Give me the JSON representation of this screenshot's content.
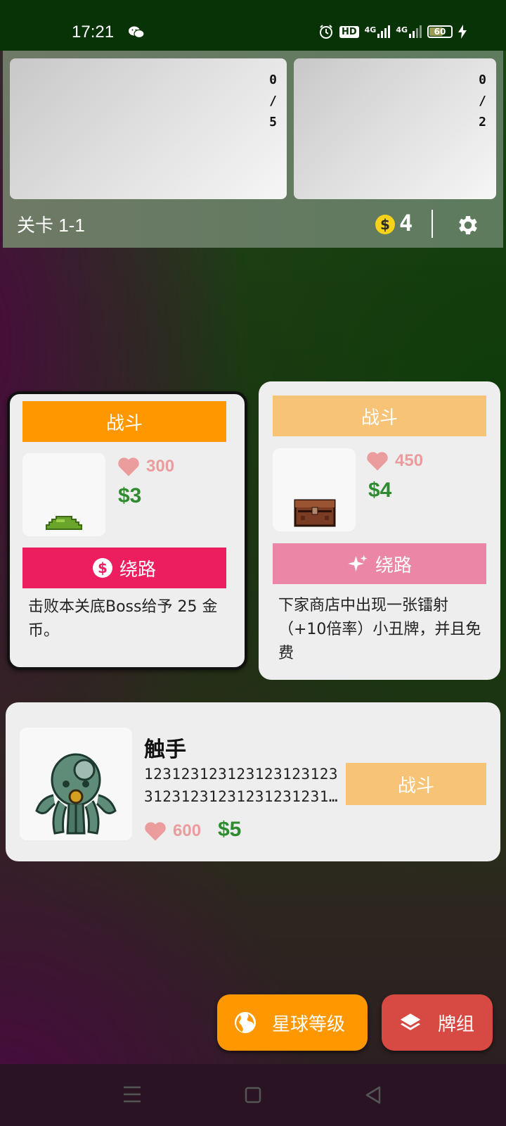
{
  "status_bar": {
    "time": "17:21",
    "icons": [
      "wechat-icon",
      "alarm-icon",
      "hd-icon",
      "signal-4g-icon",
      "signal-4g-icon",
      "battery-icon",
      "charging-icon"
    ],
    "hd_label": "HD",
    "net1": "4G",
    "net2": "4G",
    "battery": "60"
  },
  "header": {
    "slot1": {
      "current": "0",
      "sep": "/",
      "total": "5"
    },
    "slot2": {
      "current": "0",
      "sep": "/",
      "total": "2"
    },
    "level": "关卡 1-1",
    "coin_symbol": "$",
    "coins": "4"
  },
  "cards": [
    {
      "fight_label": "战斗",
      "hp": "300",
      "money": "$3",
      "detour_label": "绕路",
      "description": "击败本关底Boss给予 25 金币。",
      "selected": true,
      "enemy_icon": "slime-icon"
    },
    {
      "fight_label": "战斗",
      "hp": "450",
      "money": "$4",
      "detour_label": "绕路",
      "description": "下家商店中出现一张镭射（+10倍率）小丑牌，并且免费",
      "selected": false,
      "enemy_icon": "chest-monster-icon"
    }
  ],
  "boss": {
    "name": "触手",
    "desc_line1": "123123123123123123123",
    "desc_line2": "312312312312312312312…",
    "hp": "600",
    "money": "$5",
    "fight_label": "战斗",
    "icon": "octopus-icon"
  },
  "fabs": {
    "planet_label": "星球等级",
    "deck_label": "牌组"
  },
  "colors": {
    "fight_active": "#ff9800",
    "fight_inactive": "#f6c377",
    "detour_active": "#ec1e60",
    "detour_inactive": "#eb86a6",
    "money": "#2f8b2f",
    "hp": "#eb9c9c",
    "deck_button": "#d74a43"
  }
}
